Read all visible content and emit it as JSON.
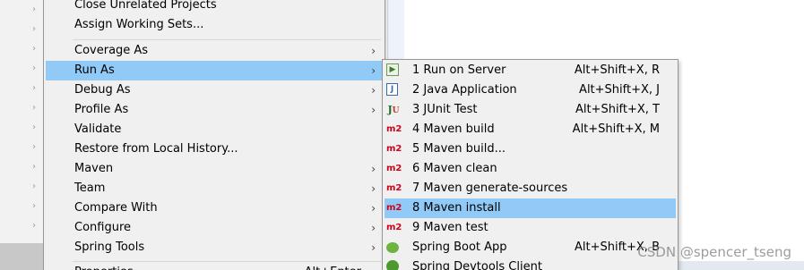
{
  "context_menu": {
    "items": [
      {
        "label": "Close Unrelated Projects",
        "has_submenu": false
      },
      {
        "label": "Assign Working Sets...",
        "has_submenu": false
      },
      {
        "label": "Coverage As",
        "has_submenu": true
      },
      {
        "label": "Run As",
        "has_submenu": true,
        "active": true
      },
      {
        "label": "Debug As",
        "has_submenu": true
      },
      {
        "label": "Profile As",
        "has_submenu": true
      },
      {
        "label": "Validate",
        "has_submenu": false
      },
      {
        "label": "Restore from Local History...",
        "has_submenu": false
      },
      {
        "label": "Maven",
        "has_submenu": true
      },
      {
        "label": "Team",
        "has_submenu": true
      },
      {
        "label": "Compare With",
        "has_submenu": true
      },
      {
        "label": "Configure",
        "has_submenu": true
      },
      {
        "label": "Spring Tools",
        "has_submenu": true
      },
      {
        "label": "Properties",
        "shortcut": "Alt+Enter"
      }
    ],
    "submenu_arrow": "›"
  },
  "run_as_submenu": {
    "items": [
      {
        "icon": "server-icon",
        "icon_text": "▶",
        "label": "1 Run on Server",
        "shortcut": "Alt+Shift+X, R"
      },
      {
        "icon": "java-application-icon",
        "icon_text": "J",
        "label": "2 Java Application",
        "shortcut": "Alt+Shift+X, J"
      },
      {
        "icon": "junit-icon",
        "icon_text": "J",
        "icon_text_2": "U",
        "label": "3 JUnit Test",
        "shortcut": "Alt+Shift+X, T"
      },
      {
        "icon": "maven-icon",
        "icon_text": "m2",
        "label": "4 Maven build",
        "shortcut": "Alt+Shift+X, M"
      },
      {
        "icon": "maven-icon",
        "icon_text": "m2",
        "label": "5 Maven build...",
        "shortcut": ""
      },
      {
        "icon": "maven-icon",
        "icon_text": "m2",
        "label": "6 Maven clean",
        "shortcut": ""
      },
      {
        "icon": "maven-icon",
        "icon_text": "m2",
        "label": "7 Maven generate-sources",
        "shortcut": ""
      },
      {
        "icon": "maven-icon",
        "icon_text": "m2",
        "label": "8 Maven install",
        "shortcut": "",
        "active": true
      },
      {
        "icon": "maven-icon",
        "icon_text": "m2",
        "label": "9 Maven test",
        "shortcut": ""
      },
      {
        "icon": "spring-boot-icon",
        "icon_text": "",
        "label": "Spring Boot App",
        "shortcut": "Alt+Shift+X, B"
      },
      {
        "icon": "spring-devtools-icon",
        "icon_text": "",
        "label": "Spring Devtools Client",
        "shortcut": ""
      }
    ]
  },
  "watermark": "CSDN @spencer_tseng",
  "colors": {
    "menu_bg": "#f0f0f0",
    "highlight": "#91c9f7",
    "maven_red": "#d0021b",
    "spring_green": "#6db33f"
  }
}
